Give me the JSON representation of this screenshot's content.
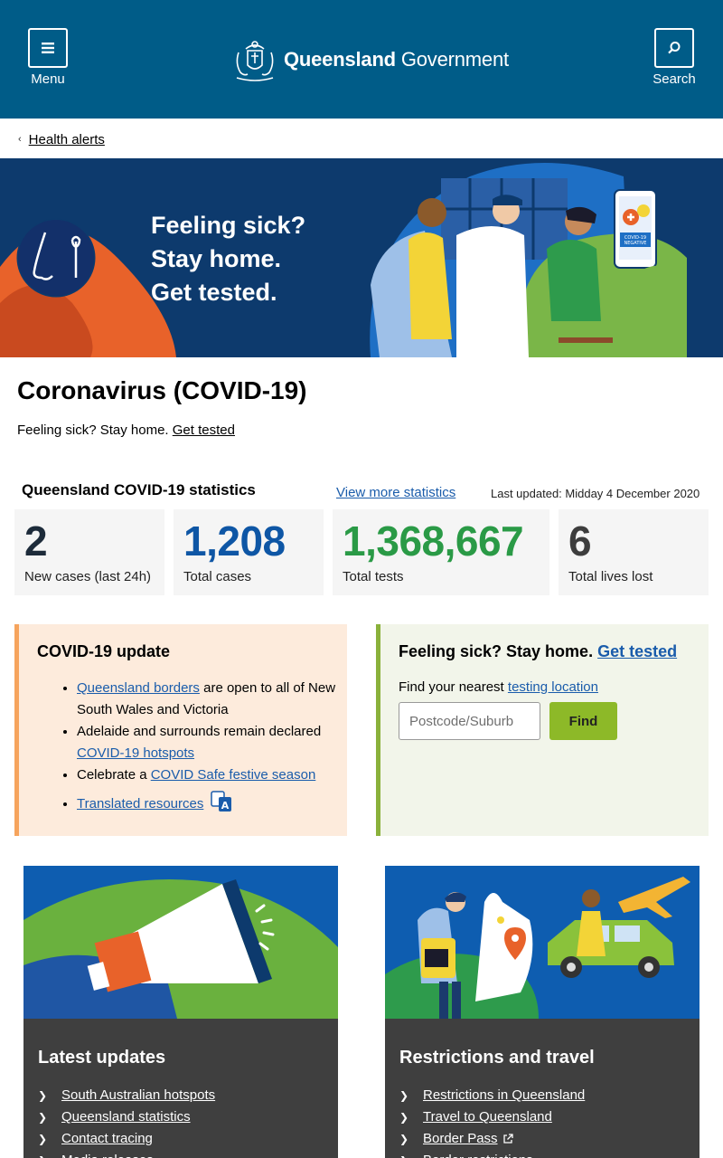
{
  "header": {
    "menu_label": "Menu",
    "search_label": "Search",
    "brand_bold": "Queensland",
    "brand_rest": "Government"
  },
  "breadcrumb": {
    "link": "Health alerts"
  },
  "banner": {
    "line1": "Feeling sick?",
    "line2": "Stay home.",
    "line3": "Get tested.",
    "phone_text": "COVID-19 NEGATIVE"
  },
  "page": {
    "title": "Coronavirus (COVID-19)",
    "intro_text": "Feeling sick? Stay home. ",
    "intro_link": "Get tested"
  },
  "stats": {
    "title": "Queensland COVID-19 statistics",
    "more_link": "View more statistics",
    "updated": "Last updated: Midday 4 December 2020",
    "cards": [
      {
        "value": "2",
        "label": "New cases (last 24h)",
        "color": "#1d2b3a"
      },
      {
        "value": "1,208",
        "label": "Total cases",
        "color": "#0e56a5"
      },
      {
        "value": "1,368,667",
        "label": "Total tests",
        "color": "#2a9a46"
      },
      {
        "value": "6",
        "label": "Total lives lost",
        "color": "#3d3d3d"
      }
    ]
  },
  "update": {
    "title": "COVID-19 update",
    "item1_link": "Queensland borders",
    "item1_text": " are open to all of New South Wales and Victoria",
    "item2_text": "Adelaide and surrounds remain declared ",
    "item2_link": "COVID-19 hotspots",
    "item3_text": "Celebrate a ",
    "item3_link": "COVID Safe festive season",
    "item4_link": "Translated resources",
    "item4_icon": "translate-icon"
  },
  "sick": {
    "title_text": "Feeling sick? Stay home. ",
    "title_link": "Get tested",
    "find_text": "Find your nearest ",
    "find_link": "testing location",
    "placeholder": "Postcode/Suburb",
    "button": "Find"
  },
  "cards": [
    {
      "title": "Latest updates",
      "icon": "megaphone-icon",
      "links": [
        "South Australian hotspots",
        "Queensland statistics",
        "Contact tracing",
        "Media releases"
      ]
    },
    {
      "title": "Restrictions and travel",
      "icon": "travel-icon",
      "links": [
        "Restrictions in Queensland",
        "Travel to Queensland",
        "Border Pass",
        "Border restrictions"
      ]
    }
  ],
  "colors": {
    "header_bg": "#005c88",
    "banner_bg": "#0d3a6d",
    "update_accent": "#f6a45d",
    "sick_accent": "#8ab13b",
    "find_button": "#8db928",
    "link": "#1a5cab",
    "card_bg": "#3f3f3f"
  }
}
